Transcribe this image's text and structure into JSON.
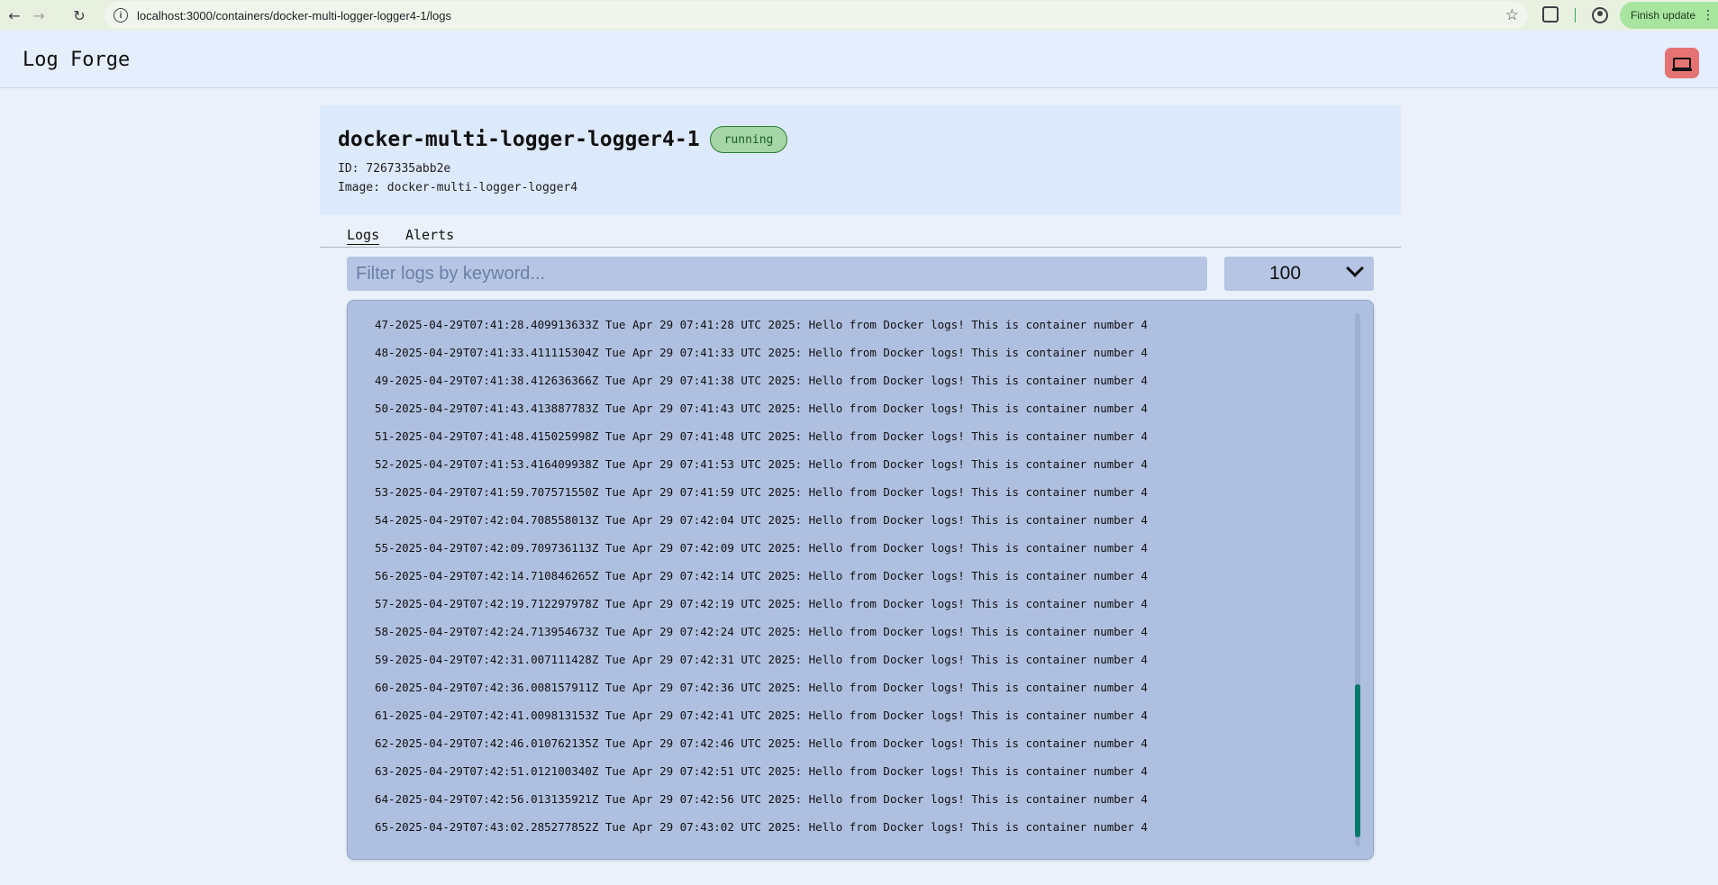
{
  "browser": {
    "url": "localhost:3000/containers/docker-multi-logger-logger4-1/logs",
    "finish_update_label": "Finish update"
  },
  "app": {
    "title": "Log Forge"
  },
  "container": {
    "name": "docker-multi-logger-logger4-1",
    "status": "running",
    "id_line": "ID: 7267335abb2e",
    "image_line": "Image: docker-multi-logger-logger4"
  },
  "tabs": [
    {
      "label": "Logs",
      "active": true
    },
    {
      "label": "Alerts",
      "active": false
    }
  ],
  "filter": {
    "placeholder": "Filter logs by keyword...",
    "value": ""
  },
  "limit": {
    "selected": "100"
  },
  "logs": [
    "47-2025-04-29T07:41:28.409913633Z Tue Apr 29 07:41:28 UTC 2025: Hello from Docker logs! This is container number 4",
    "48-2025-04-29T07:41:33.411115304Z Tue Apr 29 07:41:33 UTC 2025: Hello from Docker logs! This is container number 4",
    "49-2025-04-29T07:41:38.412636366Z Tue Apr 29 07:41:38 UTC 2025: Hello from Docker logs! This is container number 4",
    "50-2025-04-29T07:41:43.413887783Z Tue Apr 29 07:41:43 UTC 2025: Hello from Docker logs! This is container number 4",
    "51-2025-04-29T07:41:48.415025998Z Tue Apr 29 07:41:48 UTC 2025: Hello from Docker logs! This is container number 4",
    "52-2025-04-29T07:41:53.416409938Z Tue Apr 29 07:41:53 UTC 2025: Hello from Docker logs! This is container number 4",
    "53-2025-04-29T07:41:59.707571550Z Tue Apr 29 07:41:59 UTC 2025: Hello from Docker logs! This is container number 4",
    "54-2025-04-29T07:42:04.708558013Z Tue Apr 29 07:42:04 UTC 2025: Hello from Docker logs! This is container number 4",
    "55-2025-04-29T07:42:09.709736113Z Tue Apr 29 07:42:09 UTC 2025: Hello from Docker logs! This is container number 4",
    "56-2025-04-29T07:42:14.710846265Z Tue Apr 29 07:42:14 UTC 2025: Hello from Docker logs! This is container number 4",
    "57-2025-04-29T07:42:19.712297978Z Tue Apr 29 07:42:19 UTC 2025: Hello from Docker logs! This is container number 4",
    "58-2025-04-29T07:42:24.713954673Z Tue Apr 29 07:42:24 UTC 2025: Hello from Docker logs! This is container number 4",
    "59-2025-04-29T07:42:31.007111428Z Tue Apr 29 07:42:31 UTC 2025: Hello from Docker logs! This is container number 4",
    "60-2025-04-29T07:42:36.008157911Z Tue Apr 29 07:42:36 UTC 2025: Hello from Docker logs! This is container number 4",
    "61-2025-04-29T07:42:41.009813153Z Tue Apr 29 07:42:41 UTC 2025: Hello from Docker logs! This is container number 4",
    "62-2025-04-29T07:42:46.010762135Z Tue Apr 29 07:42:46 UTC 2025: Hello from Docker logs! This is container number 4",
    "63-2025-04-29T07:42:51.012100340Z Tue Apr 29 07:42:51 UTC 2025: Hello from Docker logs! This is container number 4",
    "64-2025-04-29T07:42:56.013135921Z Tue Apr 29 07:42:56 UTC 2025: Hello from Docker logs! This is container number 4",
    "65-2025-04-29T07:43:02.285277852Z Tue Apr 29 07:43:02 UTC 2025: Hello from Docker logs! This is container number 4"
  ],
  "colors": {
    "status_running": "#a5d6a7",
    "scroll_thumb": "#00796b",
    "laptop_button": "#e57373"
  }
}
